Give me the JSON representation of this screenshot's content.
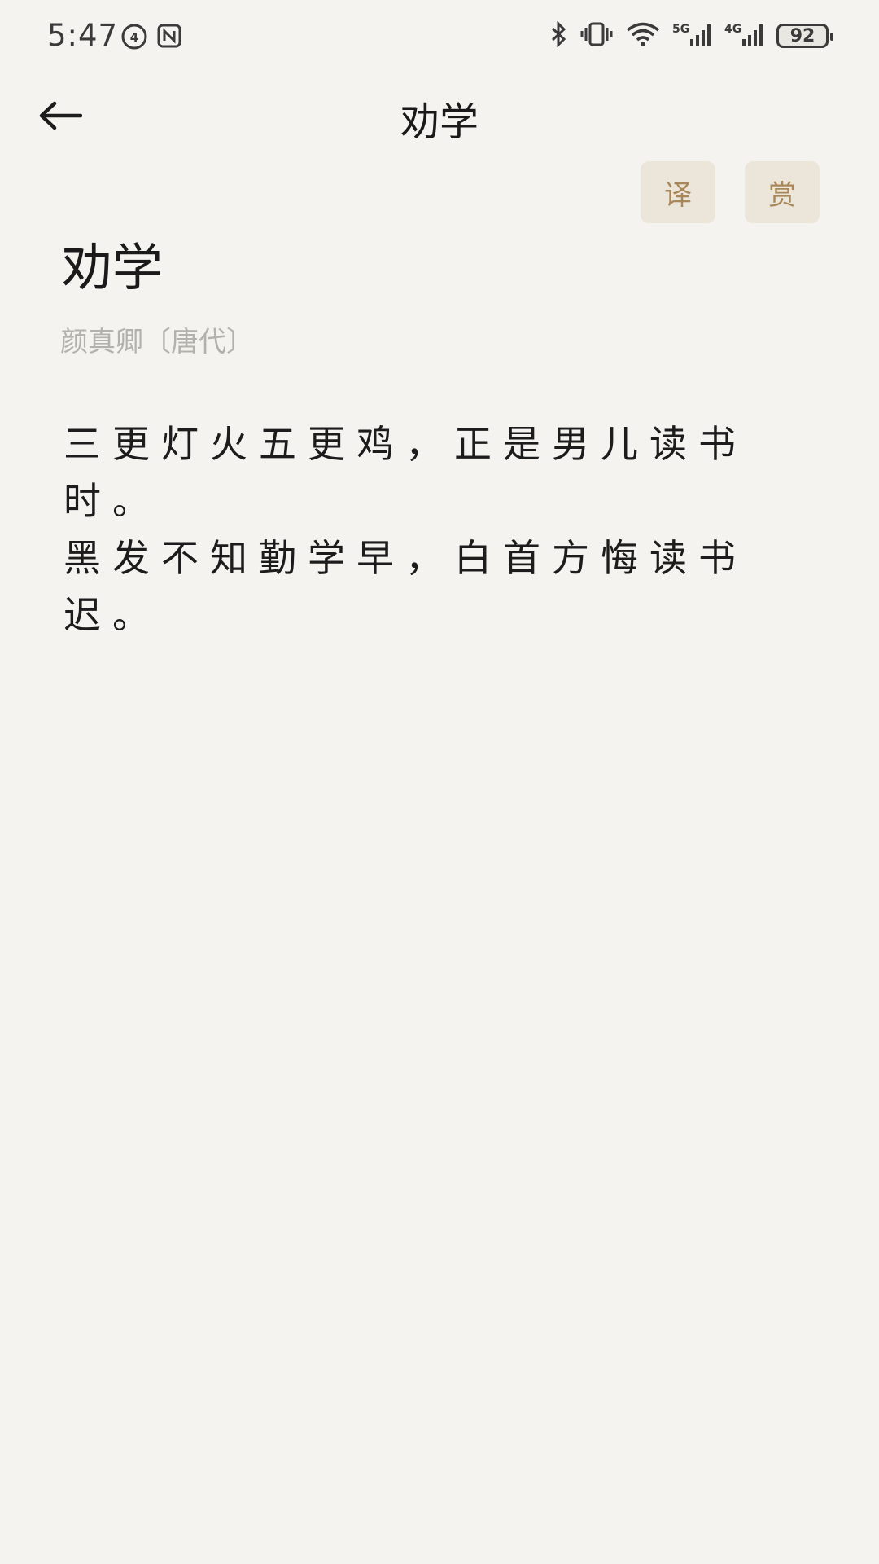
{
  "status_bar": {
    "time": "5:47",
    "battery": "92",
    "left_icons": [
      "hd-call-icon",
      "nfc-icon"
    ],
    "right_icons": [
      "bluetooth-icon",
      "vibrate-icon",
      "wifi-icon",
      "signal-5g-icon",
      "signal-4g-icon"
    ]
  },
  "app_bar": {
    "title": "劝学",
    "back_icon": "back-arrow-icon"
  },
  "actions": {
    "translate_label": "译",
    "appreciate_label": "赏"
  },
  "poem": {
    "title": "劝学",
    "author": "颜真卿〔唐代〕",
    "lines": [
      "三更灯火五更鸡，正是男儿读书时。",
      "黑发不知勤学早，白首方悔读书迟。"
    ]
  },
  "colors": {
    "background": "#f4f3ef",
    "chip_bg": "#ebe6d9",
    "chip_text": "#a8875a",
    "author_text": "#b3b1ab"
  }
}
